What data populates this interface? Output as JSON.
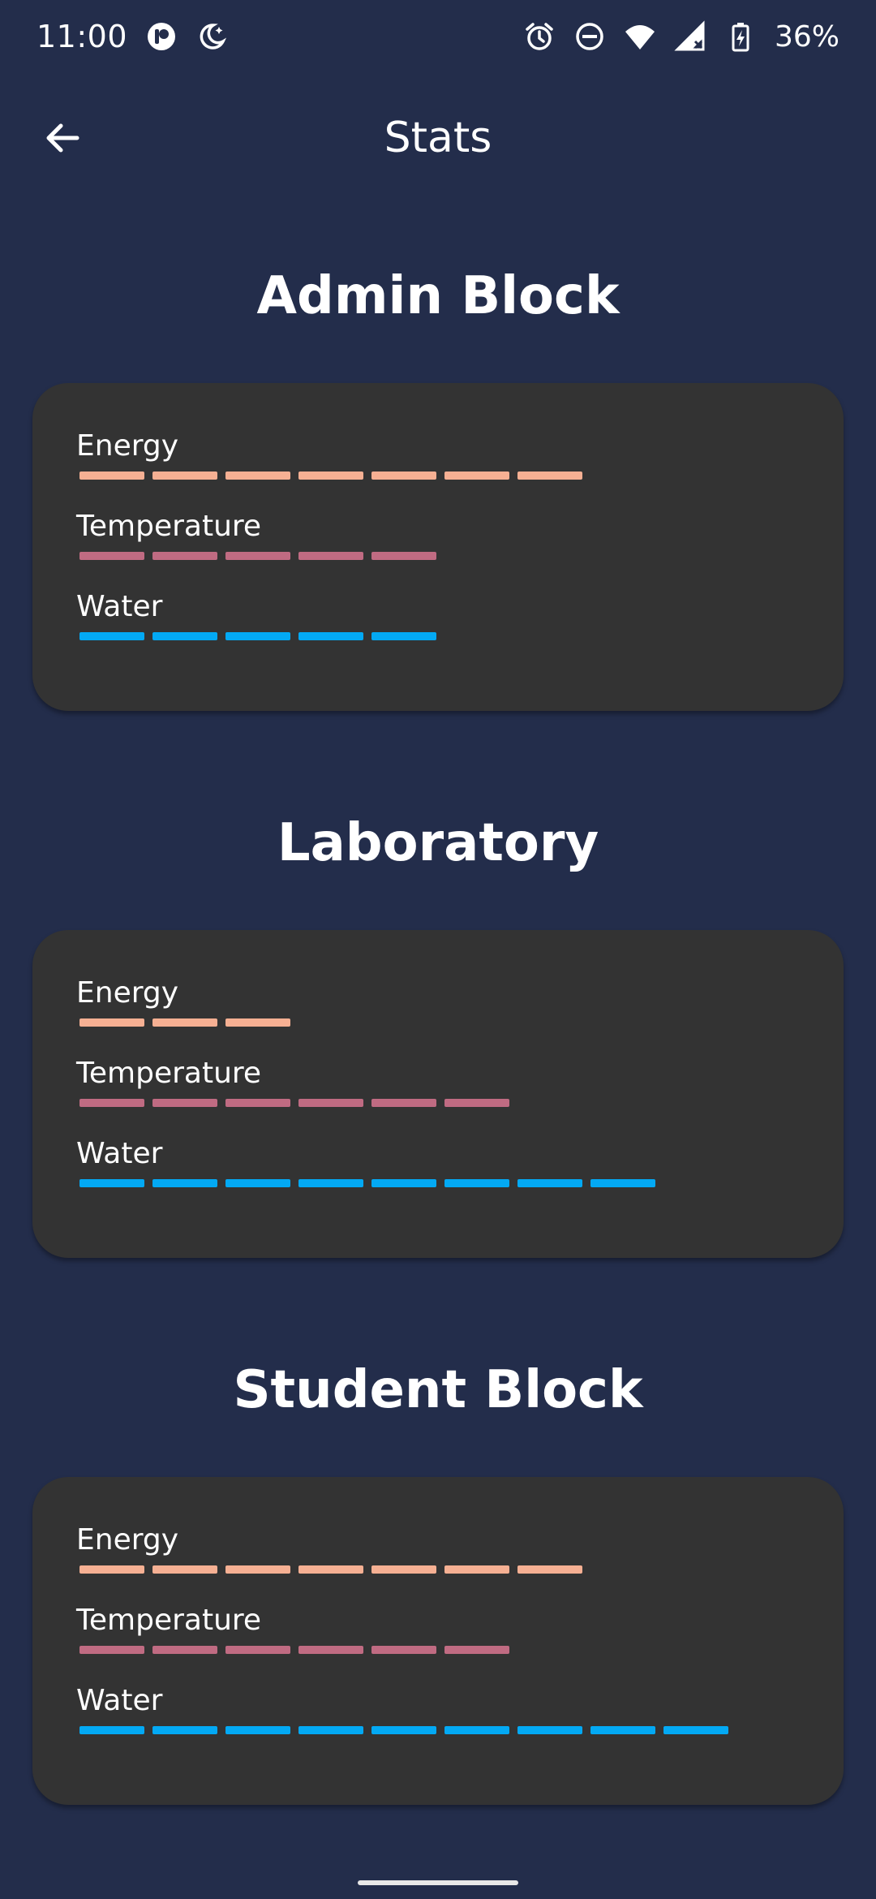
{
  "status_bar": {
    "time": "11:00",
    "battery_text": "36%",
    "left_icons": [
      "pocket-casts-icon",
      "night-mode-icon"
    ],
    "right_icons": [
      "alarm-icon",
      "do-not-disturb-icon",
      "wifi-icon",
      "signal-icon",
      "battery-charging-icon"
    ]
  },
  "appbar": {
    "title": "Stats",
    "back_icon": "arrow-back-icon"
  },
  "colors": {
    "background": "#232d4b",
    "card": "#333333",
    "energy": "#f6b093",
    "temperature": "#c06b82",
    "water": "#03a9f4"
  },
  "sections": [
    {
      "title": "Admin Block",
      "metrics": [
        {
          "label": "Energy",
          "level": 7,
          "color": "#f6b093"
        },
        {
          "label": "Temperature",
          "level": 5,
          "color": "#c06b82"
        },
        {
          "label": "Water",
          "level": 5,
          "color": "#03a9f4"
        }
      ]
    },
    {
      "title": "Laboratory",
      "metrics": [
        {
          "label": "Energy",
          "level": 3,
          "color": "#f6b093"
        },
        {
          "label": "Temperature",
          "level": 6,
          "color": "#c06b82"
        },
        {
          "label": "Water",
          "level": 8,
          "color": "#03a9f4"
        }
      ]
    },
    {
      "title": "Student Block",
      "metrics": [
        {
          "label": "Energy",
          "level": 7,
          "color": "#f6b093"
        },
        {
          "label": "Temperature",
          "level": 6,
          "color": "#c06b82"
        },
        {
          "label": "Water",
          "level": 9,
          "color": "#03a9f4"
        }
      ]
    }
  ]
}
